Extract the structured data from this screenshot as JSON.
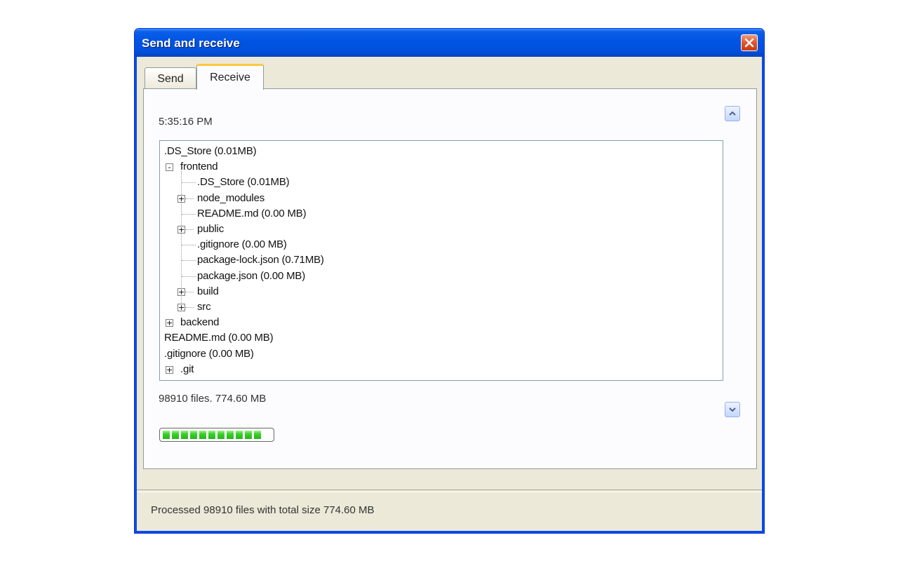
{
  "window": {
    "title": "Send and receive"
  },
  "tabs": [
    {
      "label": "Send"
    },
    {
      "label": "Receive"
    }
  ],
  "receive": {
    "timestamp": "5:35:16 PM",
    "tree": [
      {
        "label": ".DS_Store (0.01MB)",
        "level": 0,
        "expander": null
      },
      {
        "label": "frontend",
        "level": 0,
        "expander": "-"
      },
      {
        "label": ".DS_Store (0.01MB)",
        "level": 1,
        "expander": null
      },
      {
        "label": "node_modules",
        "level": 1,
        "expander": "+"
      },
      {
        "label": "README.md (0.00 MB)",
        "level": 1,
        "expander": null
      },
      {
        "label": "public",
        "level": 1,
        "expander": "+"
      },
      {
        "label": ".gitignore (0.00 MB)",
        "level": 1,
        "expander": null
      },
      {
        "label": "package-lock.json (0.71MB)",
        "level": 1,
        "expander": null
      },
      {
        "label": "package.json (0.00 MB)",
        "level": 1,
        "expander": null
      },
      {
        "label": "build",
        "level": 1,
        "expander": "+"
      },
      {
        "label": "src",
        "level": 1,
        "expander": "+"
      },
      {
        "label": "backend",
        "level": 0,
        "expander": "+"
      },
      {
        "label": "README.md (0.00 MB)",
        "level": 0,
        "expander": null
      },
      {
        "label": ".gitignore (0.00 MB)",
        "level": 0,
        "expander": null
      },
      {
        "label": ".git",
        "level": 0,
        "expander": "+"
      }
    ],
    "summary": "98910 files. 774.60 MB",
    "progress_percent": 100
  },
  "status": {
    "text": "Processed 98910 files with total size 774.60 MB"
  },
  "colors": {
    "title_bar": "#0054e3",
    "active_tab_accent": "#ffc83c",
    "progress_fill": "#3bd02b",
    "close_button": "#e3542a"
  }
}
